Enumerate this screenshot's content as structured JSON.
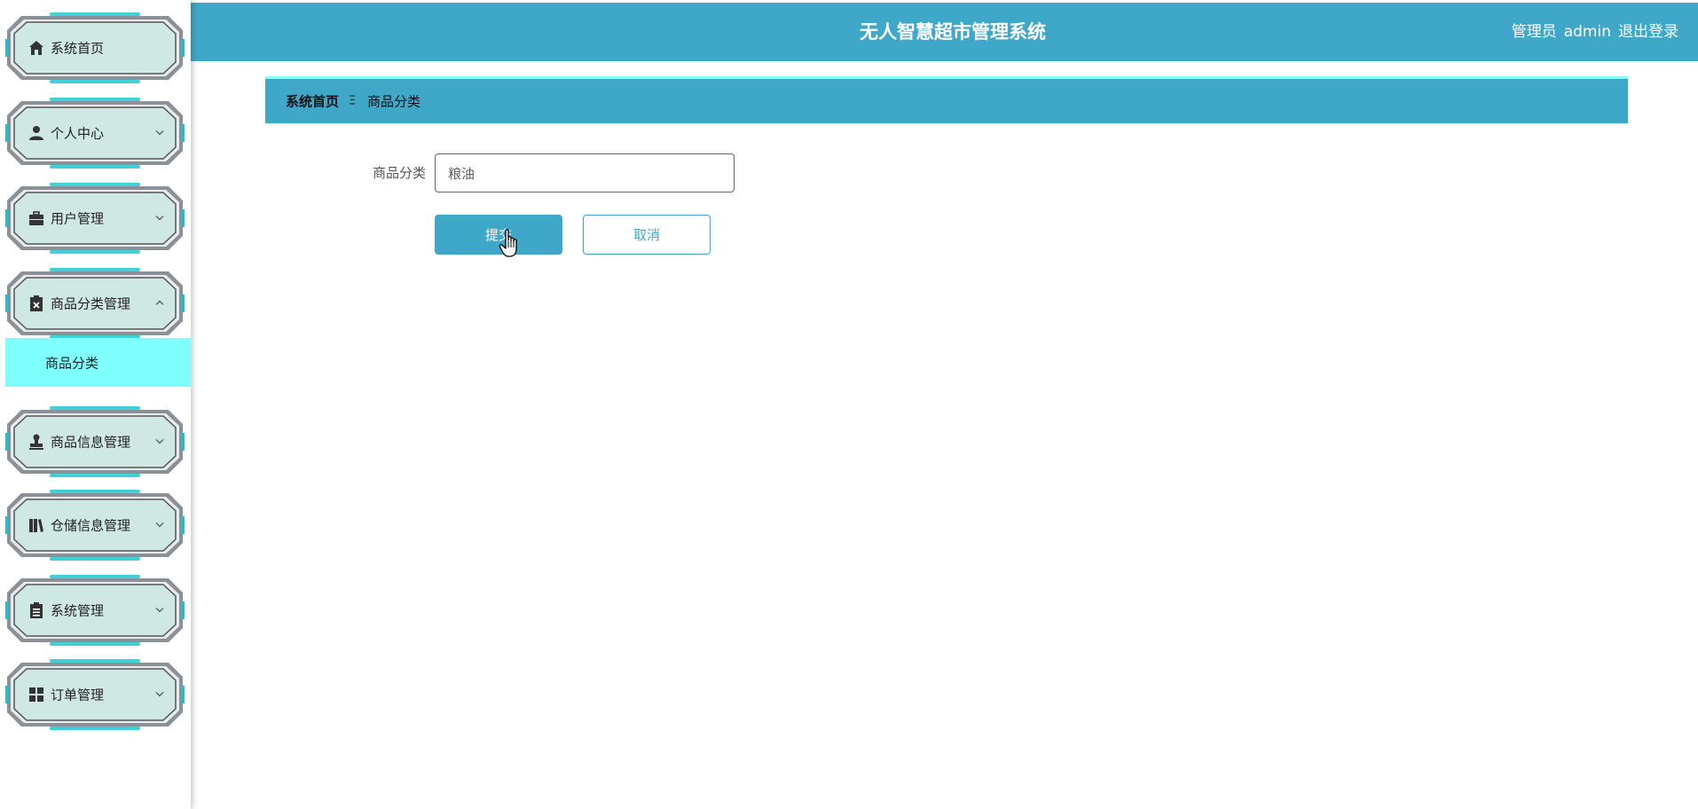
{
  "header": {
    "title": "无人智慧超市管理系统",
    "role": "管理员",
    "username": "admin",
    "logout_label": "退出登录"
  },
  "sidebar": {
    "items": [
      {
        "label": "系统首页",
        "icon": "home-icon",
        "has_chevron": false
      },
      {
        "label": "个人中心",
        "icon": "user-icon",
        "has_chevron": true,
        "expanded": false
      },
      {
        "label": "用户管理",
        "icon": "briefcase-icon",
        "has_chevron": true,
        "expanded": false
      },
      {
        "label": "商品分类管理",
        "icon": "clipboard-x-icon",
        "has_chevron": true,
        "expanded": true
      },
      {
        "label": "商品信息管理",
        "icon": "stamp-icon",
        "has_chevron": true,
        "expanded": false
      },
      {
        "label": "仓储信息管理",
        "icon": "books-icon",
        "has_chevron": true,
        "expanded": false
      },
      {
        "label": "系统管理",
        "icon": "clipboard-icon",
        "has_chevron": true,
        "expanded": false
      },
      {
        "label": "订单管理",
        "icon": "grid-icon",
        "has_chevron": true,
        "expanded": false
      }
    ],
    "submenu": {
      "label": "商品分类"
    }
  },
  "breadcrumb": {
    "home": "系统首页",
    "separator": "Ξ",
    "current": "商品分类"
  },
  "form": {
    "category_label": "商品分类",
    "category_value": "粮油",
    "submit_label": "提交",
    "cancel_label": "取消"
  },
  "colors": {
    "primary": "#3fa7c8",
    "accent_cyan": "#80ffff",
    "menu_fill": "#cfe8e4"
  }
}
